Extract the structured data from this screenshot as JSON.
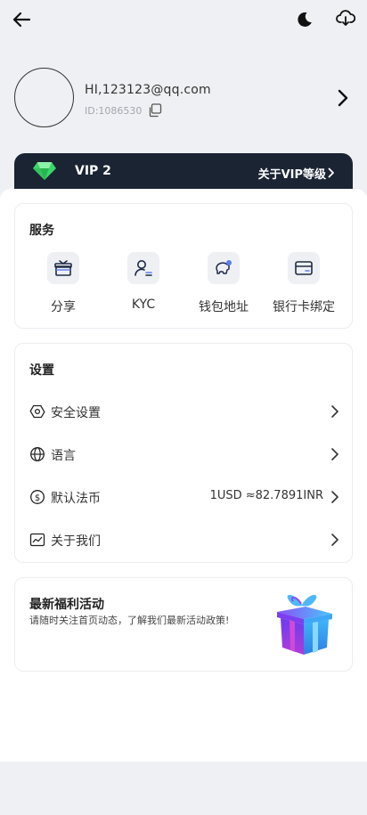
{
  "header": {
    "back_icon": "arrow-left-icon",
    "theme_icon": "moon-icon",
    "download_icon": "download-icon"
  },
  "profile": {
    "email": "HI,123123@qq.com",
    "uid": "ID:1086530",
    "copy_icon": "copy-icon",
    "chevron_icon": "chevron-right-icon"
  },
  "vip": {
    "level": "VIP 2",
    "link_label": "关于VIP等级",
    "gem_icon": "diamond-icon",
    "bar_color": "#1b2433"
  },
  "services": {
    "title": "服务",
    "items": [
      {
        "label": "分享",
        "icon": "gift-icon"
      },
      {
        "label": "KYC",
        "icon": "user-id-icon"
      },
      {
        "label": "钱包地址",
        "icon": "piggy-bank-icon"
      },
      {
        "label": "银行卡绑定",
        "icon": "bank-card-icon"
      }
    ]
  },
  "settings": {
    "title": "设置",
    "items": [
      {
        "label": "安全设置",
        "icon": "shield-hexagon-icon",
        "value": ""
      },
      {
        "label": "语言",
        "icon": "globe-icon",
        "value": ""
      },
      {
        "label": "默认法币",
        "icon": "dollar-icon",
        "value": "1USD ≈82.7891INR"
      },
      {
        "label": "关于我们",
        "icon": "chart-icon",
        "value": ""
      }
    ]
  },
  "promo": {
    "title": "最新福利活动",
    "description": "请随时关注首页动态，了解我们最新活动政策!",
    "image_icon": "gift-box-icon",
    "accent_color": "#8a3ff0"
  }
}
